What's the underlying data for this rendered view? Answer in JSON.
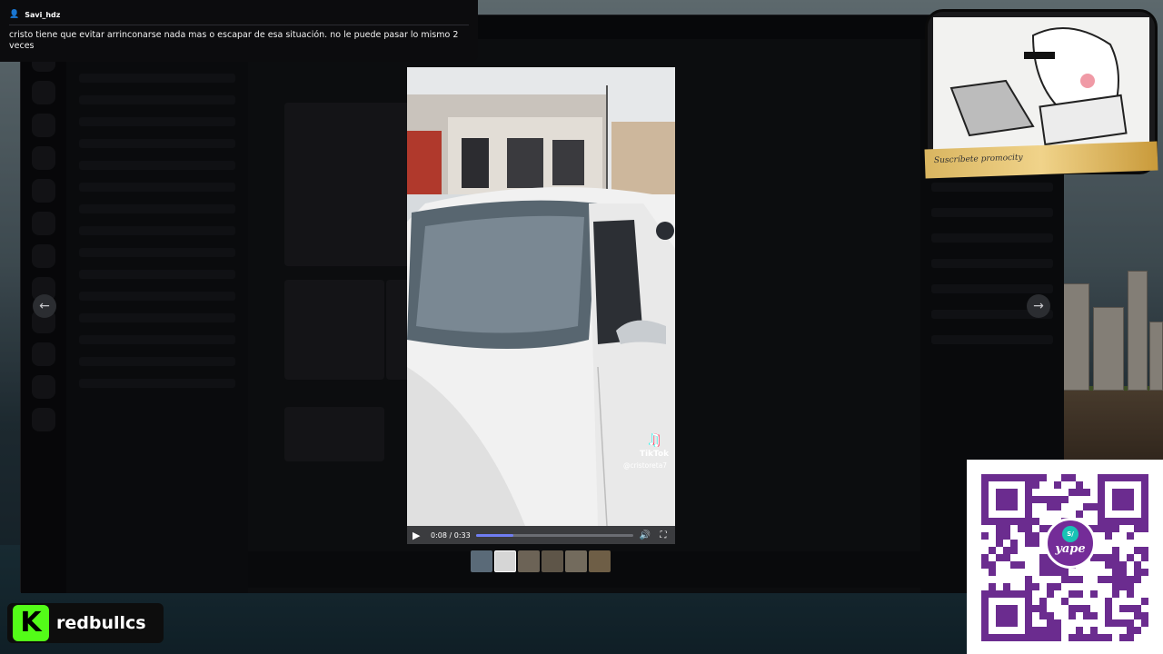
{
  "chat": {
    "username": "Savi_hdz",
    "message": "cristo tiene que evitar arrinconarse nada mas o escapar de esa situación. no le puede pasar lo mismo 2 veces"
  },
  "video": {
    "current_time": "0:08",
    "duration": "0:33",
    "time_display": "0:08 / 0:33",
    "progress": 0.24,
    "watermark_text": "TikTok",
    "watermark_handle": "@cristoreta7",
    "accent_color": "#6f7df2"
  },
  "overlay": {
    "signature": "Suscríbete promocity"
  },
  "qr": {
    "logo_badge": "S/",
    "logo_text": "yape",
    "color": "#6b2c8f"
  },
  "channel": {
    "name": "redbullcs",
    "logo_letter": "K",
    "logo_color": "#53fc18"
  },
  "icons": {
    "user": "user-icon",
    "prev": "arrow-left-icon",
    "next": "arrow-right-icon",
    "play": "play-icon",
    "volume": "volume-icon",
    "fullscreen": "fullscreen-icon"
  }
}
